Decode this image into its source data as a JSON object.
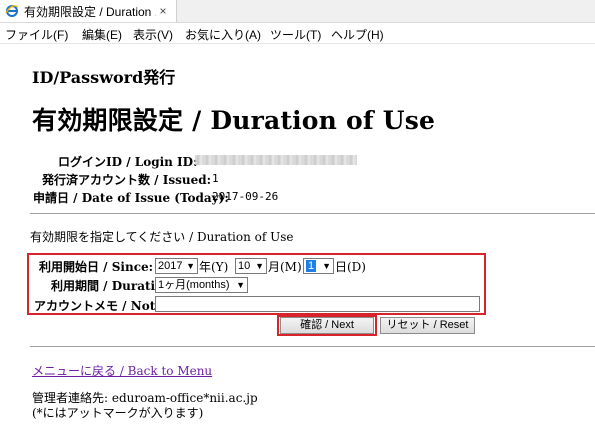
{
  "tab": {
    "title": "有効期限設定 / Duration ...",
    "close_glyph": "×"
  },
  "menu": [
    "ファイル(F)",
    "編集(E)",
    "表示(V)",
    "お気に入り(A)",
    "ツール(T)",
    "ヘルプ(H)"
  ],
  "page": {
    "subtitle": "ID/Password発行",
    "title": "有効期限設定 / Duration of Use"
  },
  "info": {
    "login_label": "ログインID / Login ID:",
    "issued_label": "発行済アカウント数 / Issued:",
    "issued_value": "1",
    "date_label": "申請日 / Date of Issue (Today):",
    "date_value": "2017-09-26"
  },
  "instruction": "有効期限を指定してください / Duration of Use",
  "form": {
    "since_label": "利用開始日 / Since:",
    "year_value": "2017",
    "year_unit": "年(Y)",
    "month_value": "10",
    "month_unit": "月(M)",
    "day_value": "1",
    "day_unit": "日(D)",
    "duration_label": "利用期間 / Duration:",
    "duration_value": "1ヶ月(months)",
    "note_label": "アカウントメモ / Note:",
    "note_value": ""
  },
  "buttons": {
    "confirm": "確認 / Next",
    "reset": "リセット / Reset"
  },
  "back_link": "メニューに戻る / Back to Menu",
  "contact": {
    "line1": "管理者連絡先: eduroam-office*nii.ac.jp",
    "line2": "(*にはアットマークが入ります)"
  },
  "colors": {
    "highlight_border": "#d8232a",
    "link": "#6b1fa3",
    "selection": "#1e7fe8"
  }
}
